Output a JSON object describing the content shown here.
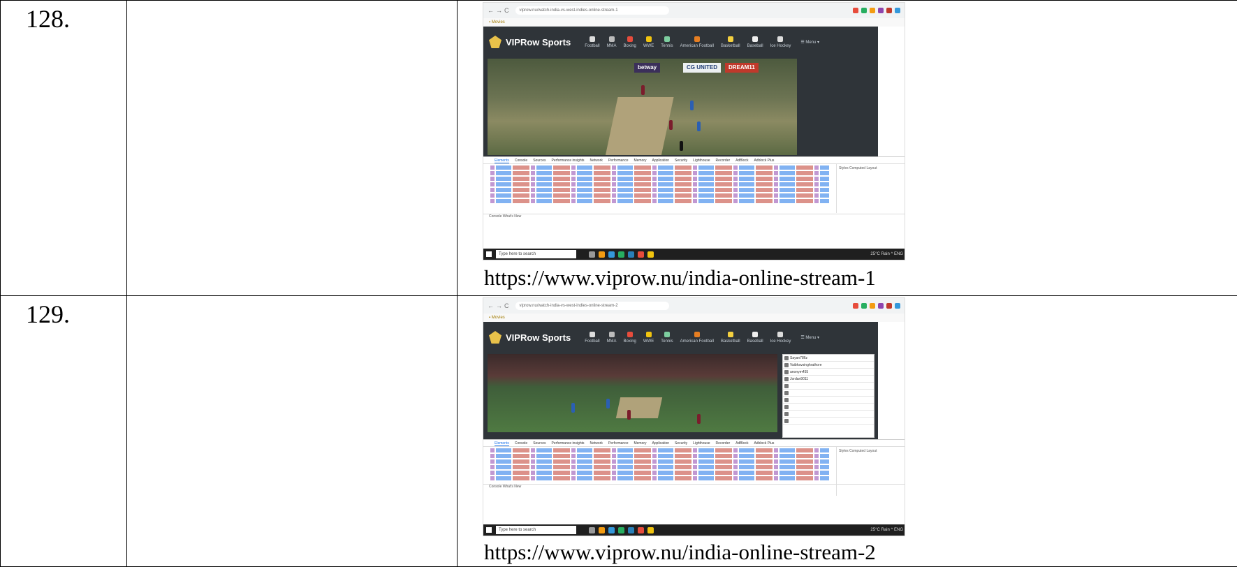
{
  "rows": [
    {
      "number": "128.",
      "url": "https://www.viprow.nu/india-online-stream-1",
      "screenshot": {
        "site_title": "VIPRow Sports",
        "nav": [
          "Football",
          "MMA",
          "Boxing",
          "WWE",
          "Tennis",
          "American Football",
          "Basketball",
          "Baseball",
          "Ice Hockey"
        ],
        "menu_label": "☰ Menu ▾",
        "banners": [
          "betway",
          "CG UNITED",
          "DREAM11"
        ],
        "devtools_tabs": [
          "Elements",
          "Console",
          "Sources",
          "Performance insights",
          "Network",
          "Performance",
          "Memory",
          "Application",
          "Security",
          "Lighthouse",
          "Recorder",
          "AdBlock",
          "Adblock Plus"
        ],
        "styles_label": "Styles  Computed  Layout",
        "console_label": "Console   What's New",
        "taskbar_search": "Type here to search",
        "tray": "25°C Rain ^ ENG"
      }
    },
    {
      "number": "129.",
      "url": "https://www.viprow.nu/india-online-stream-2",
      "screenshot": {
        "site_title": "VIPRow Sports",
        "nav": [
          "Football",
          "MMA",
          "Boxing",
          "WWE",
          "Tennis",
          "American Football",
          "Basketball",
          "Baseball",
          "Ice Hockey"
        ],
        "menu_label": "☰ Menu ▾",
        "chat_rows": [
          "Sayan786z",
          "Vaibhavsinghrathore",
          "anonym455",
          "Jordan9011",
          "",
          "",
          "",
          "",
          "",
          ""
        ],
        "devtools_tabs": [
          "Elements",
          "Console",
          "Sources",
          "Performance insights",
          "Network",
          "Performance",
          "Memory",
          "Application",
          "Security",
          "Lighthouse",
          "Recorder",
          "AdBlock",
          "Adblock Plus"
        ],
        "styles_label": "Styles  Computed  Layout",
        "console_label": "Console   What's New",
        "taskbar_search": "Type here to search",
        "tray": "25°C Rain ^ ENG"
      }
    }
  ],
  "icon_names": {
    "nav_icons": [
      "football-icon",
      "mma-icon",
      "boxing-icon",
      "wwe-icon",
      "tennis-icon",
      "american-football-icon",
      "basketball-icon",
      "baseball-icon",
      "ice-hockey-icon"
    ],
    "colors": {
      "site_bg": "#2f3439",
      "logo": "#e8c14a",
      "devtools_accent": "#1a73e8"
    }
  }
}
